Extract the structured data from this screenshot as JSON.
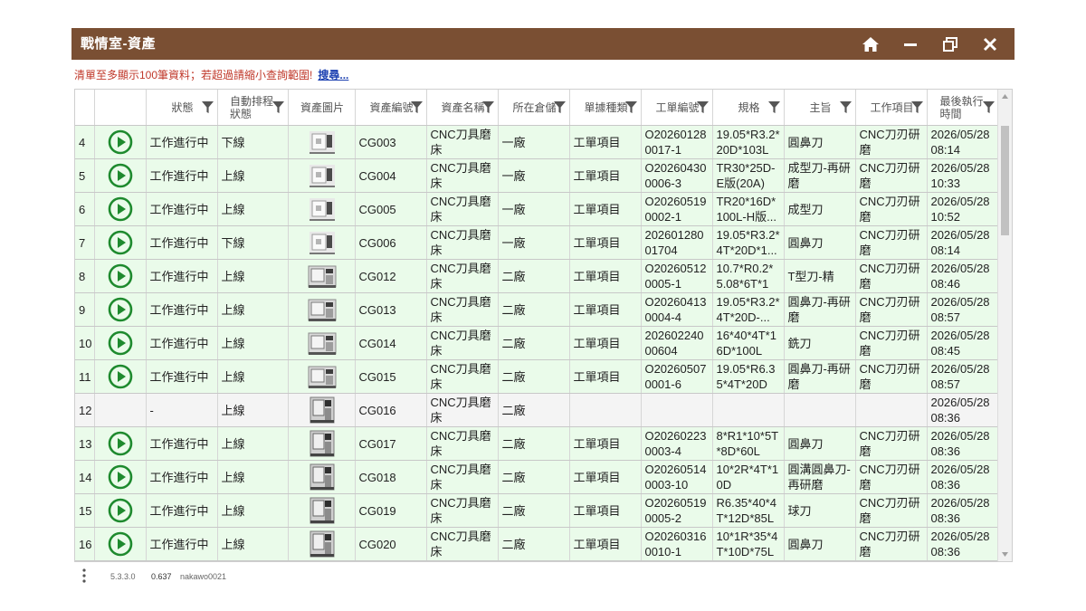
{
  "window": {
    "title": "戰情室-資產",
    "home_icon": "home-icon",
    "minimize_icon": "minimize-icon",
    "restore_icon": "restore-icon",
    "close_icon": "close-icon"
  },
  "notice": {
    "text": "清單至多顯示100筆資料；若超過請縮小查詢範圍!",
    "link": "搜尋..."
  },
  "colors": {
    "titlebar": "#7a4f33",
    "active_row": "#eafbea",
    "play_icon": "#1e8a2e",
    "notice_text": "#c0392b"
  },
  "table": {
    "columns": [
      "",
      "",
      "狀態",
      "自動排程狀態",
      "資產圖片",
      "資產編號",
      "資產名稱",
      "所在倉儲",
      "單據種類",
      "工單編號",
      "規格",
      "主旨",
      "工作項目",
      "最後執行時間"
    ],
    "rows": [
      {
        "idx": "4",
        "play": true,
        "status": "工作進行中",
        "auto": "下線",
        "img": "machine-small",
        "asset_no": "CG003",
        "name": "CNC刀具磨床",
        "wh": "一廠",
        "doc": "工單項目",
        "wo": "O202601280017-1",
        "spec": "19.05*R3.2*20D*103L",
        "subject": "圓鼻刀",
        "work": "CNC刀刃研磨",
        "last": "2026/05/28 08:14"
      },
      {
        "idx": "5",
        "play": true,
        "status": "工作進行中",
        "auto": "上線",
        "img": "machine-small",
        "asset_no": "CG004",
        "name": "CNC刀具磨床",
        "wh": "一廠",
        "doc": "工單項目",
        "wo": "O202604300006-3",
        "spec": "TR30*25D-E版(20A)",
        "subject": "成型刀-再研磨",
        "work": "CNC刀刃研磨",
        "last": "2026/05/28 10:33"
      },
      {
        "idx": "6",
        "play": true,
        "status": "工作進行中",
        "auto": "上線",
        "img": "machine-small",
        "asset_no": "CG005",
        "name": "CNC刀具磨床",
        "wh": "一廠",
        "doc": "工單項目",
        "wo": "O202605190002-1",
        "spec": "TR20*16D*100L-H版...",
        "subject": "成型刀",
        "work": "CNC刀刃研磨",
        "last": "2026/05/28 10:52"
      },
      {
        "idx": "7",
        "play": true,
        "status": "工作進行中",
        "auto": "下線",
        "img": "machine-small",
        "asset_no": "CG006",
        "name": "CNC刀具磨床",
        "wh": "一廠",
        "doc": "工單項目",
        "wo": "20260128001704",
        "spec": "19.05*R3.2*4T*20D*1...",
        "subject": "圓鼻刀",
        "work": "CNC刀刃研磨",
        "last": "2026/05/28 08:14"
      },
      {
        "idx": "8",
        "play": true,
        "status": "工作進行中",
        "auto": "上線",
        "img": "machine-box",
        "asset_no": "CG012",
        "name": "CNC刀具磨床",
        "wh": "二廠",
        "doc": "工單項目",
        "wo": "O202605120005-1",
        "spec": "10.7*R0.2*5.08*6T*12...",
        "subject": "T型刀-精",
        "work": "CNC刀刃研磨",
        "last": "2026/05/28 08:46"
      },
      {
        "idx": "9",
        "play": true,
        "status": "工作進行中",
        "auto": "上線",
        "img": "machine-box",
        "asset_no": "CG013",
        "name": "CNC刀具磨床",
        "wh": "二廠",
        "doc": "工單項目",
        "wo": "O202604130004-4",
        "spec": "19.05*R3.2*4T*20D-...",
        "subject": "圓鼻刀-再研磨",
        "work": "CNC刀刃研磨",
        "last": "2026/05/28 08:57"
      },
      {
        "idx": "10",
        "play": true,
        "status": "工作進行中",
        "auto": "上線",
        "img": "machine-box",
        "asset_no": "CG014",
        "name": "CNC刀具磨床",
        "wh": "二廠",
        "doc": "工單項目",
        "wo": "20260224000604",
        "spec": "16*40*4T*16D*100L",
        "subject": "銑刀",
        "work": "CNC刀刃研磨",
        "last": "2026/05/28 08:45"
      },
      {
        "idx": "11",
        "play": true,
        "status": "工作進行中",
        "auto": "上線",
        "img": "machine-box",
        "asset_no": "CG015",
        "name": "CNC刀具磨床",
        "wh": "二廠",
        "doc": "工單項目",
        "wo": "O202605070001-6",
        "spec": "19.05*R6.35*4T*20D",
        "subject": "圓鼻刀-再研磨",
        "work": "CNC刀刃研磨",
        "last": "2026/05/28 08:57"
      },
      {
        "idx": "12",
        "play": false,
        "status": "-",
        "auto": "上線",
        "img": "machine-tall",
        "asset_no": "CG016",
        "name": "CNC刀具磨床",
        "wh": "二廠",
        "doc": "",
        "wo": "",
        "spec": "",
        "subject": "",
        "work": "",
        "last": "2026/05/28 08:36"
      },
      {
        "idx": "13",
        "play": true,
        "status": "工作進行中",
        "auto": "上線",
        "img": "machine-tall",
        "asset_no": "CG017",
        "name": "CNC刀具磨床",
        "wh": "二廠",
        "doc": "工單項目",
        "wo": "O202602230003-4",
        "spec": "8*R1*10*5T*8D*60L",
        "subject": "圓鼻刀",
        "work": "CNC刀刃研磨",
        "last": "2026/05/28 08:36"
      },
      {
        "idx": "14",
        "play": true,
        "status": "工作進行中",
        "auto": "上線",
        "img": "machine-tall",
        "asset_no": "CG018",
        "name": "CNC刀具磨床",
        "wh": "二廠",
        "doc": "工單項目",
        "wo": "O202605140003-10",
        "spec": "10*2R*4T*10D",
        "subject": "圓溝圓鼻刀-再研磨",
        "work": "CNC刀刃研磨",
        "last": "2026/05/28 08:36"
      },
      {
        "idx": "15",
        "play": true,
        "status": "工作進行中",
        "auto": "上線",
        "img": "machine-tall",
        "asset_no": "CG019",
        "name": "CNC刀具磨床",
        "wh": "二廠",
        "doc": "工單項目",
        "wo": "O202605190005-2",
        "spec": "R6.35*40*4T*12D*85L",
        "subject": "球刀",
        "work": "CNC刀刃研磨",
        "last": "2026/05/28 08:36"
      },
      {
        "idx": "16",
        "play": true,
        "status": "工作進行中",
        "auto": "上線",
        "img": "machine-tall",
        "asset_no": "CG020",
        "name": "CNC刀具磨床",
        "wh": "二廠",
        "doc": "工單項目",
        "wo": "O202603160010-1",
        "spec": "10*1R*35*4T*10D*75L",
        "subject": "圓鼻刀",
        "work": "CNC刀刃研磨",
        "last": "2026/05/28 08:36"
      }
    ]
  },
  "footer": {
    "menu_icon": "more-vertical-icon",
    "version": "5.3.3.0",
    "load_time": "0.637",
    "user": "nakawo0021"
  }
}
